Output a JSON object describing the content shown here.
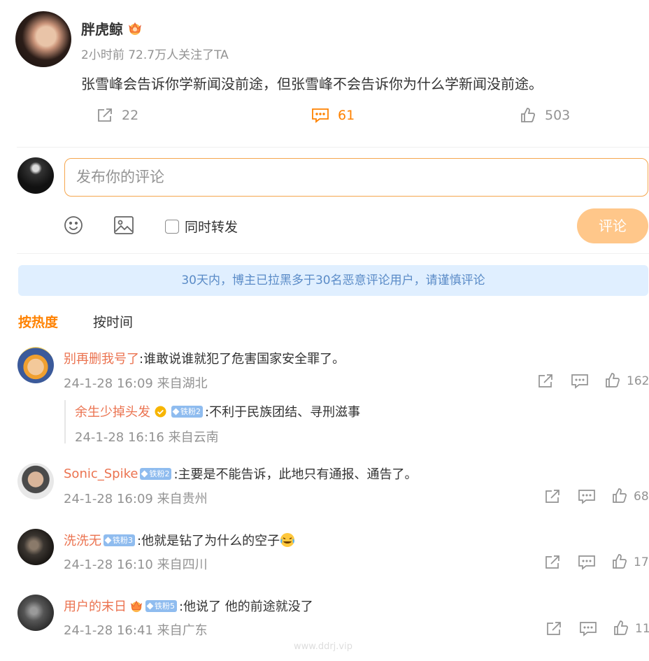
{
  "post": {
    "author": "胖虎鲸",
    "meta": "2小时前 72.7万人关注了TA",
    "text": "张雪峰会告诉你学新闻没前途，但张雪峰不会告诉你为什么学新闻没前途。",
    "repost_count": "22",
    "comment_count": "61",
    "like_count": "503"
  },
  "composer": {
    "placeholder": "发布你的评论",
    "repost_label": "同时转发",
    "submit_label": "评论"
  },
  "notice": "30天内，博主已拉黑多于30名恶意评论用户，请谨慎评论",
  "sort": {
    "hot": "按热度",
    "time": "按时间"
  },
  "comments": [
    {
      "name": "别再删我号了",
      "text": ":谁敢说谁就犯了危害国家安全罪了。",
      "meta": "24-1-28 16:09 来自湖北",
      "likes": "162",
      "reply": {
        "name": "余生少掉头发",
        "badge": "铁粉2",
        "text": ":不利于民族团结、寻刑滋事",
        "meta": "24-1-28 16:16 来自云南"
      }
    },
    {
      "name": "Sonic_Spike",
      "badge": "铁粉2",
      "text": ":主要是不能告诉，此地只有通报、通告了。",
      "meta": "24-1-28 16:09 来自贵州",
      "likes": "68"
    },
    {
      "name": "洗洗无",
      "badge": "铁粉3",
      "text": ":他就是钻了为什么的空子",
      "meta": "24-1-28 16:10 来自四川",
      "likes": "17"
    },
    {
      "name": "用户的末日",
      "badge": "铁粉5",
      "text": ":他说了 他的前途就没了",
      "meta": "24-1-28 16:41 来自广东",
      "likes": "11"
    }
  ],
  "watermark": "www.ddrj.vip",
  "colors": {
    "accent": "#ff8200",
    "name": "#eb7350",
    "badge": "#8fbcef",
    "notice_bg": "#e0efff"
  }
}
